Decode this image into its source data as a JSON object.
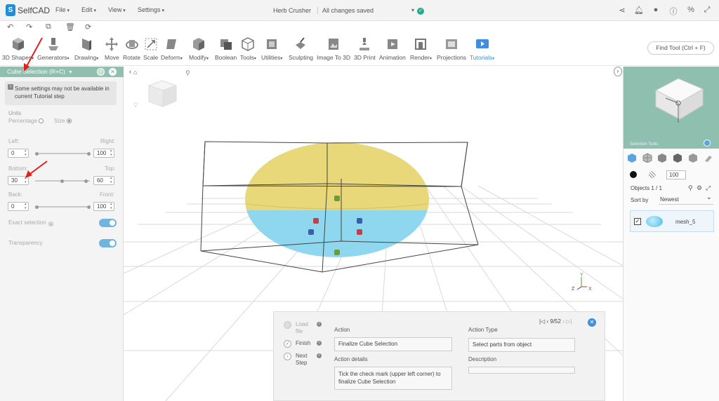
{
  "app": {
    "logo": "SelfCAD",
    "doc_title": "Herb Crusher",
    "save_status": "All changes saved"
  },
  "menus": [
    "File",
    "Edit",
    "View",
    "Settings"
  ],
  "toolbar": {
    "tools": [
      "3D Shapes",
      "Generators",
      "Drawing",
      "Move",
      "Rotate",
      "Scale",
      "Deform",
      "Modify",
      "Boolean",
      "Tools",
      "Utilities",
      "Sculpting",
      "Image To 3D",
      "3D Print",
      "Animation",
      "Render",
      "Projections",
      "Tutorials"
    ],
    "find_tool": "Find Tool (Ctrl + F)"
  },
  "left_panel": {
    "title": "Cube Selection (R+C)",
    "note": "Some settings may not be available in current Tutorial step",
    "units_label": "Units",
    "percentage_label": "Percentage",
    "size_label": "Size",
    "left_label": "Left:",
    "right_label": "Right:",
    "bottom_label": "Bottom:",
    "top_label": "Top:",
    "back_label": "Back:",
    "front_label": "Front:",
    "left_value": "0",
    "right_value": "100",
    "bottom_value": "30",
    "top_value": "60",
    "back_value": "0",
    "front_value": "100",
    "exact_selection": "Exact selection",
    "transparency": "Transparency"
  },
  "right_panel": {
    "selection_tools_label": "Selection Tools",
    "opacity_value": "100",
    "objects_count": "Objects 1 / 1",
    "sort_label": "Sort by",
    "sort_value": "Newest",
    "object_name": "mesh_5"
  },
  "tutorial": {
    "steps": [
      "Load file",
      "Finish",
      "Next Step"
    ],
    "action_label": "Action",
    "action_value": "Finalize Cube Selection",
    "action_type_label": "Action Type",
    "action_type_value": "Select parts from object",
    "details_label": "Action details",
    "details_value": "Tick the check mark (upper left corner) to finalize Cube Selection",
    "description_label": "Description",
    "step_counter": "9/52"
  },
  "axes": {
    "x": "X",
    "y": "Y",
    "z": "Z"
  },
  "colors": {
    "panel_header": "#8fbfae",
    "accent": "#3f8ee0",
    "arrow": "#e0201c",
    "dome_top": "#e8d87a",
    "dome_bottom": "#8fd6ef"
  }
}
